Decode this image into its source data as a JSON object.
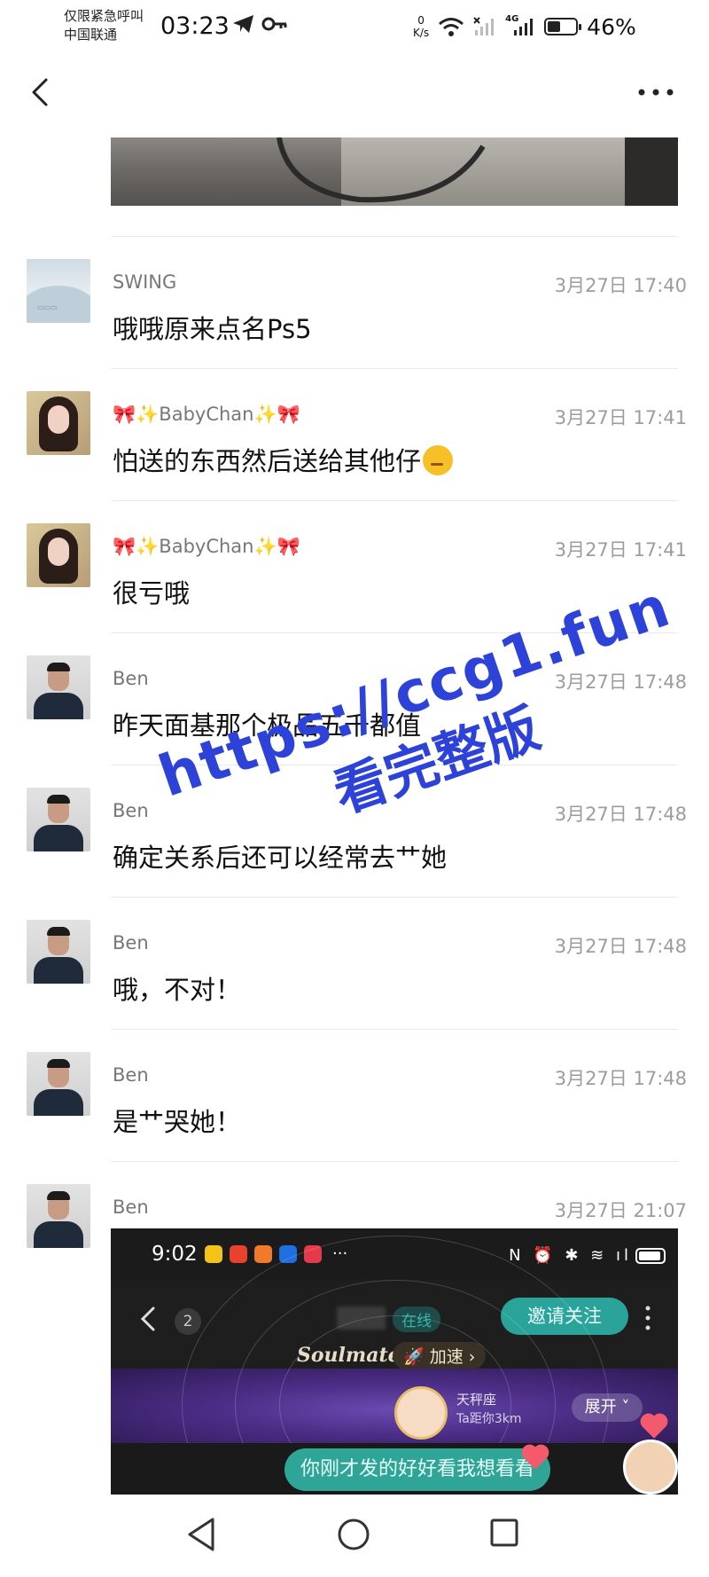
{
  "status_bar": {
    "carrier_line1": "仅限紧急呼叫",
    "carrier_line2": "中国联通",
    "time": "03:23",
    "net_speed_value": "0",
    "net_speed_unit": "K/s",
    "network": "4G",
    "battery_level": 0.46,
    "battery_percent": "46%"
  },
  "top_bar": {
    "back_icon": "chevron-left-icon",
    "more_icon": "more-horizontal-icon"
  },
  "comments": [
    {
      "name": "SWING",
      "time": "3月27日 17:40",
      "text": "哦哦原来点名Ps5",
      "avatar": "landscape-placeholder"
    },
    {
      "name": "🎀✨BabyChan✨🎀",
      "time": "3月27日 17:41",
      "text": "怕送的东西然后送给其他仔",
      "emoji": "thinking-face",
      "avatar": "woman-photo"
    },
    {
      "name": "🎀✨BabyChan✨🎀",
      "time": "3月27日 17:41",
      "text": "很亏哦",
      "avatar": "woman-photo"
    },
    {
      "name": "Ben",
      "time": "3月27日 17:48",
      "text": "昨天面基那个极品五千都值",
      "avatar": "man-photo"
    },
    {
      "name": "Ben",
      "time": "3月27日 17:48",
      "text": "确定关系后还可以经常去艹她",
      "avatar": "man-photo"
    },
    {
      "name": "Ben",
      "time": "3月27日 17:48",
      "text": "哦，不对！",
      "avatar": "man-photo"
    },
    {
      "name": "Ben",
      "time": "3月27日 17:48",
      "text": "是艹哭她！",
      "avatar": "man-photo"
    },
    {
      "name": "Ben",
      "time": "3月27日 21:07",
      "text": "",
      "avatar": "man-photo"
    }
  ],
  "embedded_screenshot": {
    "time": "9:02",
    "unread_count": "2",
    "online_label": "在线",
    "invite_button": "邀请关注",
    "brand": "Soulmate",
    "boost_label": "加速",
    "zodiac": "天秤座",
    "distance": "Ta距你3km",
    "expand_button": "展开",
    "message": "你刚才发的好好看我想看看",
    "app_colors": [
      "#f2c318",
      "#e8412c",
      "#f07a2a",
      "#1f6fe0",
      "#e43a4a"
    ]
  },
  "watermark": {
    "line1": "https://ccg1.fun",
    "line2": "看完整版"
  },
  "nav_bar": {
    "back": "triangle-back-icon",
    "home": "circle-home-icon",
    "recent": "square-recent-icon"
  }
}
